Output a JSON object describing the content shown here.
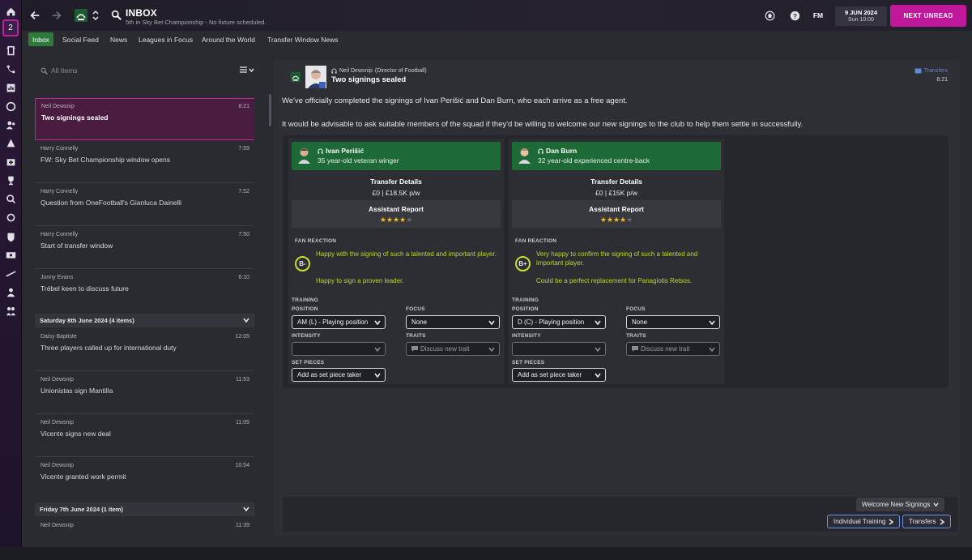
{
  "sidebar": {
    "badge_count": "2",
    "items": [
      "home-icon",
      "inbox-icon",
      "squad-icon",
      "tactics-icon",
      "data-hub-icon",
      "schedule-icon",
      "staff-icon",
      "club-vision-icon",
      "medical-icon",
      "competitions-icon",
      "scouting-icon",
      "transfers-icon",
      "club-info-icon",
      "finances-icon",
      "dev-centre-icon",
      "staff-hub-icon",
      "player-hub-icon"
    ]
  },
  "header": {
    "title": "INBOX",
    "subtitle": "5th in Sky Bet Championship - No fixture scheduled.",
    "fm_label": "FM",
    "date": "9 JUN 2024",
    "time": "Sun 10:00",
    "next_unread": "NEXT UNREAD"
  },
  "tabs": [
    "Inbox",
    "Social Feed",
    "News",
    "Leagues in Focus",
    "Around the World",
    "Transfer Window News"
  ],
  "active_tab": 0,
  "list": {
    "search_placeholder": "All Items",
    "messages": [
      {
        "sender": "Neil Dewsnip",
        "time": "8:21",
        "subject": "Two signings sealed",
        "selected": true
      },
      {
        "sender": "Harry Connelly",
        "time": "7:59",
        "subject": "FW: Sky Bet Championship window opens"
      },
      {
        "sender": "Harry Connelly",
        "time": "7:52",
        "subject": "Question from OneFootball's Gianluca Dainelli"
      },
      {
        "sender": "Harry Connelly",
        "time": "7:50",
        "subject": "Start of transfer window"
      },
      {
        "sender": "Jonny Evans",
        "time": "6:10",
        "subject": "Trébel keen to discuss future"
      }
    ],
    "group1": "Saturday 8th June 2024 (4 items)",
    "messages2": [
      {
        "sender": "Daisy Baptiste",
        "time": "12:05",
        "subject": "Three players called up for international duty"
      },
      {
        "sender": "Neil Dewsnip",
        "time": "11:53",
        "subject": "Unionistas sign Mantilla"
      },
      {
        "sender": "Neil Dewsnip",
        "time": "11:05",
        "subject": "Vicente signs new deal"
      },
      {
        "sender": "Neil Dewsnip",
        "time": "10:54",
        "subject": "Vicente granted work permit"
      }
    ],
    "group2": "Friday 7th June 2024 (1 item)",
    "messages3": [
      {
        "sender": "Neil Dewsnip",
        "time": "11:39",
        "subject": ""
      }
    ]
  },
  "detail": {
    "sender": "Neil Dewsnip",
    "sender_role": "(Director of Football)",
    "subject": "Two signings sealed",
    "tag": "Transfers",
    "time": "8:21",
    "para1": "We've officially completed the signings of Ivan Perišić and Dan Burn, who each arrive as a free agent.",
    "para2": "It would be advisable to ask suitable members of the squad if they'd be willing to welcome our new signings to the club to help them settle in successfully.",
    "labels": {
      "transfer_details": "Transfer Details",
      "assistant_report": "Assistant Report",
      "fan_reaction": "FAN REACTION",
      "training": "TRAINING",
      "position": "POSITION",
      "focus": "FOCUS",
      "intensity": "INTENSITY",
      "traits": "TRAITS",
      "set_pieces": "SET PIECES"
    },
    "cards": [
      {
        "name": "Ivan Perišić",
        "desc": "35 year-old veteran winger",
        "fee": "£0 | £18.5K p/w",
        "stars": 4,
        "grade": "B-",
        "fan1": "Happy with the signing of such a talented and important player.",
        "fan2": "Happy to sign a proven leader.",
        "position": "AM (L) - Playing position",
        "focus": "None",
        "intensity": "",
        "traits": "Discuss new trait",
        "set_pieces": "Add as set piece taker"
      },
      {
        "name": "Dan Burn",
        "desc": "32 year-old experienced centre-back",
        "fee": "£0 | £15K p/w",
        "stars": 4,
        "grade": "B+",
        "fan1": "Very happy to confirm the signing of such a talented and important player.",
        "fan2": "Could be a perfect replacement for Panagiotis Retsos.",
        "position": "D (C) - Playing position",
        "focus": "None",
        "intensity": "",
        "traits": "Discuss new trait",
        "set_pieces": "Add as set piece taker"
      }
    ],
    "footer": {
      "welcome": "Welcome New Signings",
      "individual_training": "Individual Training",
      "transfers": "Transfers"
    }
  },
  "colors": {
    "accent": "#c0189a",
    "active_tab": "#2f7a3a",
    "card_head": "#1e6a36",
    "fan_text": "#b8d82a",
    "star": "#f0b91a",
    "link": "#5a8ad8"
  }
}
